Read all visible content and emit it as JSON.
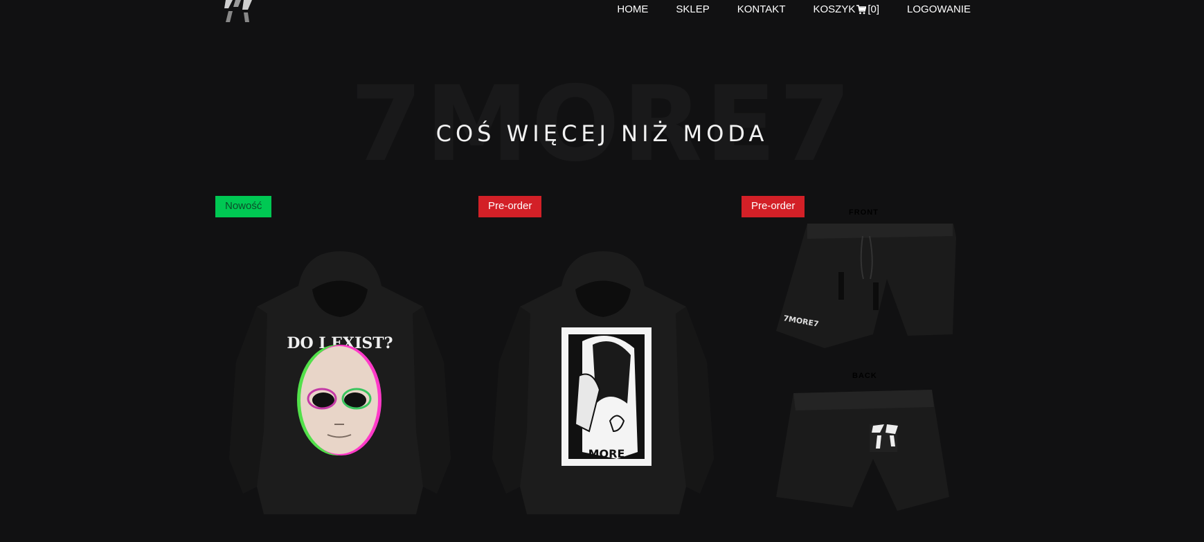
{
  "nav": {
    "home": "HOME",
    "shop": "SKLEP",
    "contact": "KONTAKT",
    "cart": "KOSZYK",
    "cart_count": "[0]",
    "login": "LOGOWANIE"
  },
  "hero": {
    "watermark": "7MORE7",
    "tagline": "COŚ WIĘCEJ NIŻ MODA"
  },
  "products": [
    {
      "badge": "Nowość",
      "badge_color": "#00c853",
      "print_text": "DO I EXIST?"
    },
    {
      "badge": "Pre-order",
      "badge_color": "#d32027"
    },
    {
      "badge": "Pre-order",
      "badge_color": "#d32027",
      "front_label": "FRONT",
      "back_label": "BACK",
      "brand": "7MORE7"
    }
  ],
  "colors": {
    "background": "#111112",
    "text": "#ffffff"
  }
}
